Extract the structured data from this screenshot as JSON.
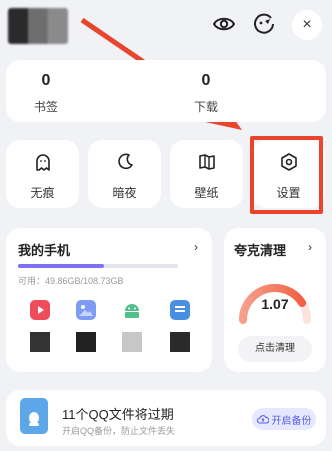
{
  "header": {
    "avatar_icon": "blurred-avatar",
    "eye_icon": "eye-icon",
    "theme_icon": "theme-face-icon",
    "close_label": "×"
  },
  "stats": [
    {
      "value": "0",
      "label": "书签"
    },
    {
      "value": "0",
      "label": "下载"
    }
  ],
  "shortcuts": [
    {
      "label": "无痕",
      "icon": "ghost-icon"
    },
    {
      "label": "暗夜",
      "icon": "moon-icon"
    },
    {
      "label": "壁纸",
      "icon": "book-icon"
    },
    {
      "label": "设置",
      "icon": "hexagon-settings-icon"
    }
  ],
  "phone": {
    "title": "我的手机",
    "chevron": "›",
    "storage_text": "可用：49.86GB/108.73GB",
    "storage_used_fraction": 0.54,
    "apps": [
      {
        "icon": "video-app-icon",
        "color": "#f04b5b"
      },
      {
        "icon": "gallery-app-icon",
        "color": "#7f9cf5"
      },
      {
        "icon": "android-app-icon",
        "color": "#52c08a"
      },
      {
        "icon": "document-app-icon",
        "color": "#4a90e2"
      }
    ],
    "thumbs": [
      "#333333",
      "#222222",
      "#c7c7c7",
      "#2a2a2a"
    ]
  },
  "clean": {
    "title": "夸克清理",
    "chevron": "›",
    "gauge_value": "1.07",
    "gauge_fraction": 0.82,
    "button_label": "点击清理",
    "accent": "#f26a52"
  },
  "banner": {
    "title": "11个QQ文件将过期",
    "subtitle": "开启QQ备份，防止文件丢失",
    "button_label": "开启备份",
    "button_icon": "cloud-upload-icon"
  }
}
